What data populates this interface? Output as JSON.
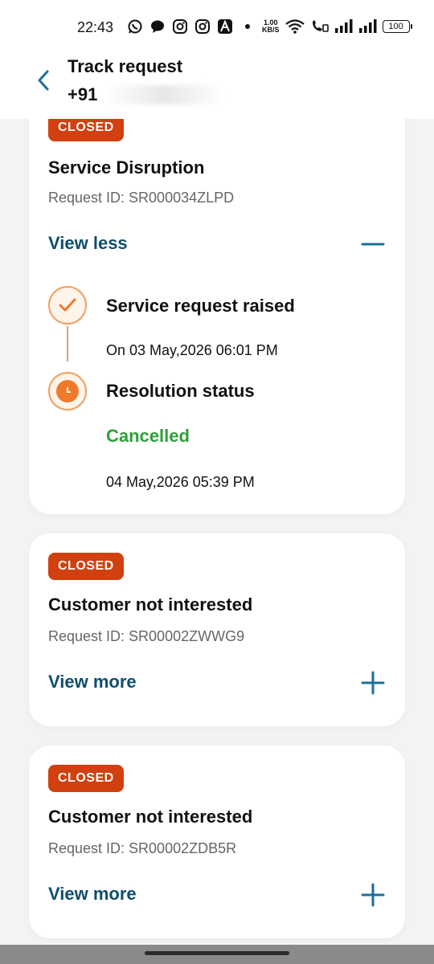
{
  "status_bar": {
    "time": "22:43",
    "net_speed_top": "1.00",
    "net_speed_bottom": "KB/S",
    "battery": "100",
    "icons_left": [
      "whatsapp-icon",
      "chat-icon",
      "instagram-icon",
      "instagram-icon",
      "a-app-icon",
      "dot-icon"
    ],
    "icons_right": [
      "wifi-icon",
      "call-icon",
      "signal-icon",
      "signal-icon",
      "battery-icon"
    ]
  },
  "header": {
    "title": "Track request",
    "subtitle": "+91"
  },
  "colors": {
    "badge": "#d1400e",
    "link": "#0f4e6b",
    "accent_icon": "#1a6f9a",
    "timeline": "#f07a2c",
    "cancelled": "#2ea03a"
  },
  "requests": [
    {
      "status": "CLOSED",
      "title": "Service Disruption",
      "request_id": "Request ID: SR000034ZLPD",
      "toggle_label": "View less",
      "expanded": true,
      "timeline": [
        {
          "title": "Service request raised",
          "date": "On 03 May,2026 06:01 PM"
        },
        {
          "title": "Resolution status",
          "status": "Cancelled",
          "date": "04 May,2026 05:39 PM"
        }
      ]
    },
    {
      "status": "CLOSED",
      "title": "Customer not interested",
      "request_id": "Request ID: SR00002ZWWG9",
      "toggle_label": "View more",
      "expanded": false
    },
    {
      "status": "CLOSED",
      "title": "Customer not interested",
      "request_id": "Request ID: SR00002ZDB5R",
      "toggle_label": "View more",
      "expanded": false
    }
  ]
}
